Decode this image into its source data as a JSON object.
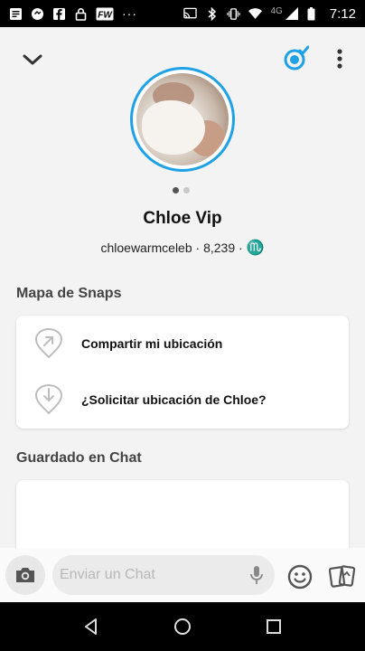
{
  "status_bar": {
    "time": "7:12",
    "network": "4G",
    "left_icons": [
      "messages-icon",
      "chat-bubble-icon",
      "facebook-icon",
      "lock-icon",
      "fw-app-icon"
    ],
    "right_icons": [
      "cast-icon",
      "bluetooth-icon",
      "vibrate-icon",
      "wifi-icon",
      "signal-icon",
      "battery-icon"
    ],
    "fw_label": "FW",
    "overflow": "···"
  },
  "profile": {
    "display_name": "Chloe Vip",
    "username": "chloewarmceleb",
    "score": "8,239",
    "zodiac": "♏",
    "separator": "·",
    "avatar_ring_color": "#1ea1e6",
    "pager_total": 2,
    "pager_active": 1
  },
  "snap_map": {
    "title": "Mapa de Snaps",
    "share_location": "Compartir mi ubicación",
    "request_location": "¿Solicitar ubicación de Chloe?"
  },
  "saved_in_chat": {
    "title": "Guardado en Chat"
  },
  "chat_bar": {
    "placeholder": "Enviar un Chat"
  },
  "colors": {
    "accent": "#1ea1e6",
    "background": "#f3f3f3"
  }
}
